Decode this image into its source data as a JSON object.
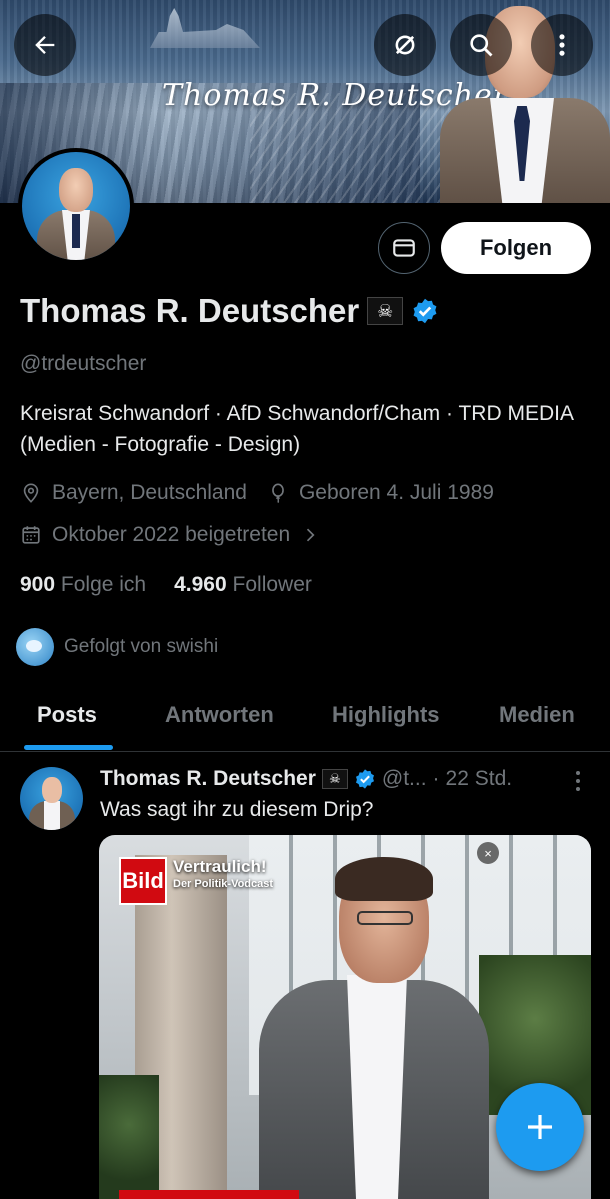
{
  "profile": {
    "name": "Thomas R. Deutscher",
    "flag_emoji": "☠",
    "handle": "@trdeutscher",
    "bio": "Kreisrat Schwandorf · AfD Schwandorf/Cham · TRD MEDIA (Medien - Fotografie - Design)",
    "location": "Bayern, Deutschland",
    "birthday": "Geboren 4. Juli 1989",
    "joined": "Oktober 2022 beigetreten",
    "following_count": "900",
    "following_label": "Folge ich",
    "followers_count": "4.960",
    "followers_label": "Follower",
    "followed_by": "Gefolgt von swishi",
    "banner_signature": "Thomas R. Deutscher"
  },
  "actions": {
    "follow_label": "Folgen"
  },
  "tabs": [
    {
      "label": "Posts",
      "active": true
    },
    {
      "label": "Antworten",
      "active": false
    },
    {
      "label": "Highlights",
      "active": false
    },
    {
      "label": "Medien",
      "active": false
    }
  ],
  "post": {
    "author": "Thomas R. Deutscher",
    "flag_emoji": "☠",
    "handle_trunc": "@t...",
    "separator": "·",
    "time": "22 Std.",
    "text": "Was sagt ihr zu diesem Drip?",
    "media": {
      "logo_text": "Bild",
      "title": "Vertraulich!",
      "subtitle": "Der Politik-Vodcast",
      "close_glyph": "×"
    }
  },
  "colors": {
    "accent": "#1d9bf0",
    "background": "#000000",
    "text_primary": "#e7e9ea",
    "text_secondary": "#71767b"
  },
  "icons": [
    "back-arrow-icon",
    "eye-off-icon",
    "search-icon",
    "more-vertical-icon",
    "mail-icon",
    "verified-badge-icon",
    "location-icon",
    "balloon-icon",
    "calendar-icon",
    "chevron-right-icon",
    "plus-icon"
  ]
}
